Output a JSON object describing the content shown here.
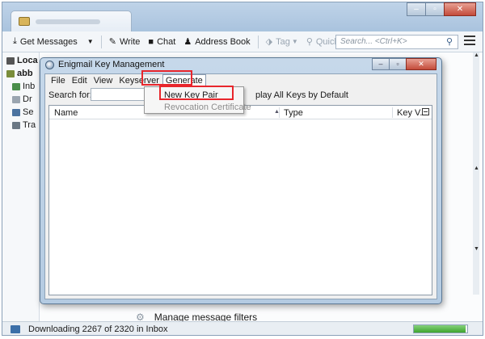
{
  "toolbar": {
    "get_messages": "Get Messages",
    "write": "Write",
    "chat": "Chat",
    "address_book": "Address Book",
    "tag": "Tag",
    "quick_filter": "Quick Filter",
    "search_placeholder": "Search... <Ctrl+K>"
  },
  "folders": [
    "Loca",
    "abb",
    "Inb",
    "Dr",
    "Se",
    "Tra"
  ],
  "background": {
    "manage_filters": "Manage message filters"
  },
  "status": {
    "text": "Downloading 2267 of 2320 in Inbox",
    "progress_fraction": 0.977
  },
  "dialog": {
    "title": "Enigmail Key Management",
    "menu": [
      "File",
      "Edit",
      "View",
      "Keyserver",
      "Generate"
    ],
    "search_label": "Search for:",
    "display_all": "play All Keys by Default",
    "columns": [
      "Name",
      "Type",
      "Key V..."
    ],
    "generate_menu": {
      "items": [
        {
          "label": "New Key Pair",
          "enabled": true
        },
        {
          "label": "Revocation Certificate",
          "enabled": false
        }
      ]
    }
  },
  "colors": {
    "highlight": "#e8262c",
    "titlebar": "#bfd3e8",
    "progress": "#3ea52f"
  }
}
